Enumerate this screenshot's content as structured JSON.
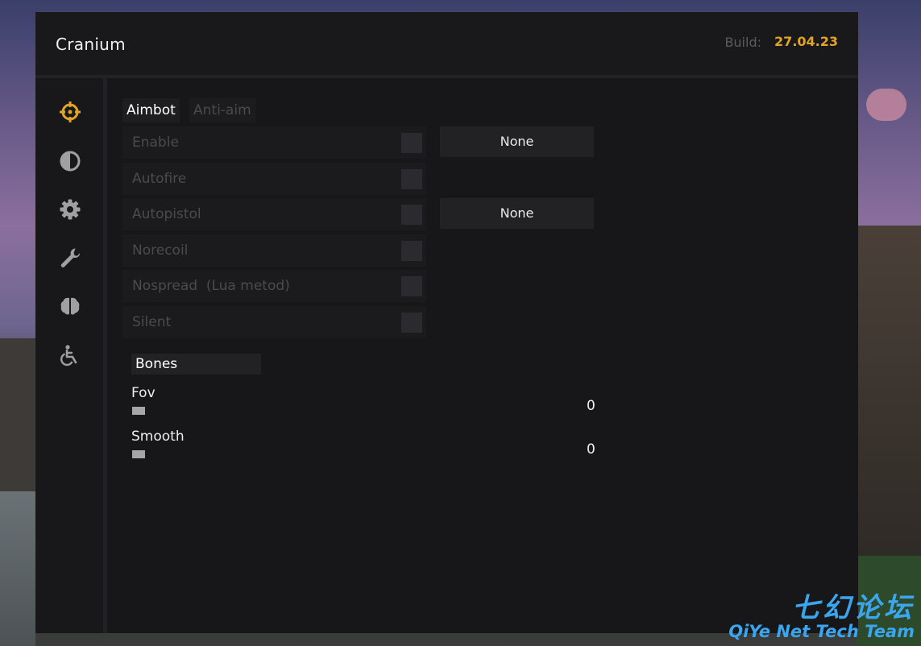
{
  "app": {
    "title": "Cranium",
    "build_label": "Build:",
    "build_value": "27.04.23",
    "accent_color": "#e0a525"
  },
  "sidebar": {
    "items": [
      {
        "icon": "crosshair-icon",
        "active": true
      },
      {
        "icon": "contrast-icon",
        "active": false
      },
      {
        "icon": "gear-icon",
        "active": false
      },
      {
        "icon": "wrench-icon",
        "active": false
      },
      {
        "icon": "brain-icon",
        "active": false
      },
      {
        "icon": "accessibility-icon",
        "active": false
      }
    ]
  },
  "tabs": [
    {
      "label": "Aimbot",
      "active": true
    },
    {
      "label": "Anti-aim",
      "active": false
    }
  ],
  "options": [
    {
      "label": "Enable",
      "checked": false,
      "keybind": "None"
    },
    {
      "label": "Autofire",
      "checked": false
    },
    {
      "label": "Autopistol",
      "checked": false,
      "keybind": "None"
    },
    {
      "label": "Norecoil",
      "checked": false
    },
    {
      "label": "Nospread  (Lua metod)",
      "checked": false
    },
    {
      "label": "Silent",
      "checked": false
    }
  ],
  "bones_button": "Bones",
  "sliders": [
    {
      "label": "Fov",
      "value": "0"
    },
    {
      "label": "Smooth",
      "value": "0"
    }
  ],
  "watermark": {
    "chinese": "七幻论坛",
    "english": "QiYe Net Tech Team"
  }
}
